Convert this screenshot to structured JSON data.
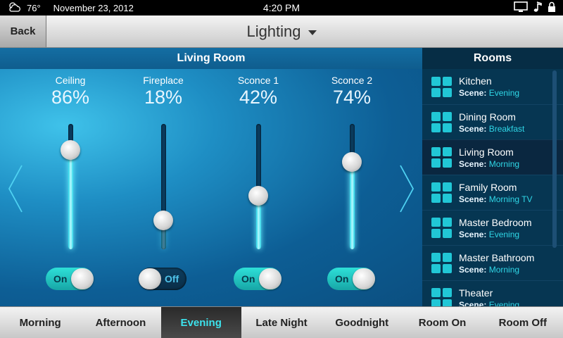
{
  "status": {
    "temperature": "76°",
    "date": "November 23, 2012",
    "time": "4:20 PM",
    "weather_icon": "partly-cloudy-icon",
    "icons": [
      "tv-icon",
      "music-note-icon",
      "lock-icon"
    ]
  },
  "header": {
    "back_label": "Back",
    "title": "Lighting"
  },
  "panel": {
    "room_title": "Living Room",
    "channels": [
      {
        "name": "Ceiling",
        "value": "86%",
        "level": 0.86,
        "toggle": "On",
        "state": "on"
      },
      {
        "name": "Fireplace",
        "value": "18%",
        "level": 0.18,
        "toggle": "Off",
        "state": "off"
      },
      {
        "name": "Sconce 1",
        "value": "42%",
        "level": 0.42,
        "toggle": "On",
        "state": "on"
      },
      {
        "name": "Sconce 2",
        "value": "74%",
        "level": 0.74,
        "toggle": "On",
        "state": "on"
      }
    ]
  },
  "rooms": {
    "title": "Rooms",
    "scene_prefix": "Scene:",
    "items": [
      {
        "name": "Kitchen",
        "scene": "Evening"
      },
      {
        "name": "Dining Room",
        "scene": "Breakfast"
      },
      {
        "name": "Living Room",
        "scene": "Morning",
        "selected": true
      },
      {
        "name": "Family Room",
        "scene": "Morning TV"
      },
      {
        "name": "Master Bedroom",
        "scene": "Evening"
      },
      {
        "name": "Master Bathroom",
        "scene": "Morning"
      },
      {
        "name": "Theater",
        "scene": "Evening"
      }
    ]
  },
  "scenes": {
    "buttons": [
      "Morning",
      "Afternoon",
      "Evening",
      "Late Night",
      "Goodnight",
      "Room On",
      "Room Off"
    ],
    "active": "Evening"
  },
  "colors": {
    "accent": "#2fd6e6",
    "panel_blue": "#1e8ec4",
    "sidebar_bg": "#063652"
  }
}
